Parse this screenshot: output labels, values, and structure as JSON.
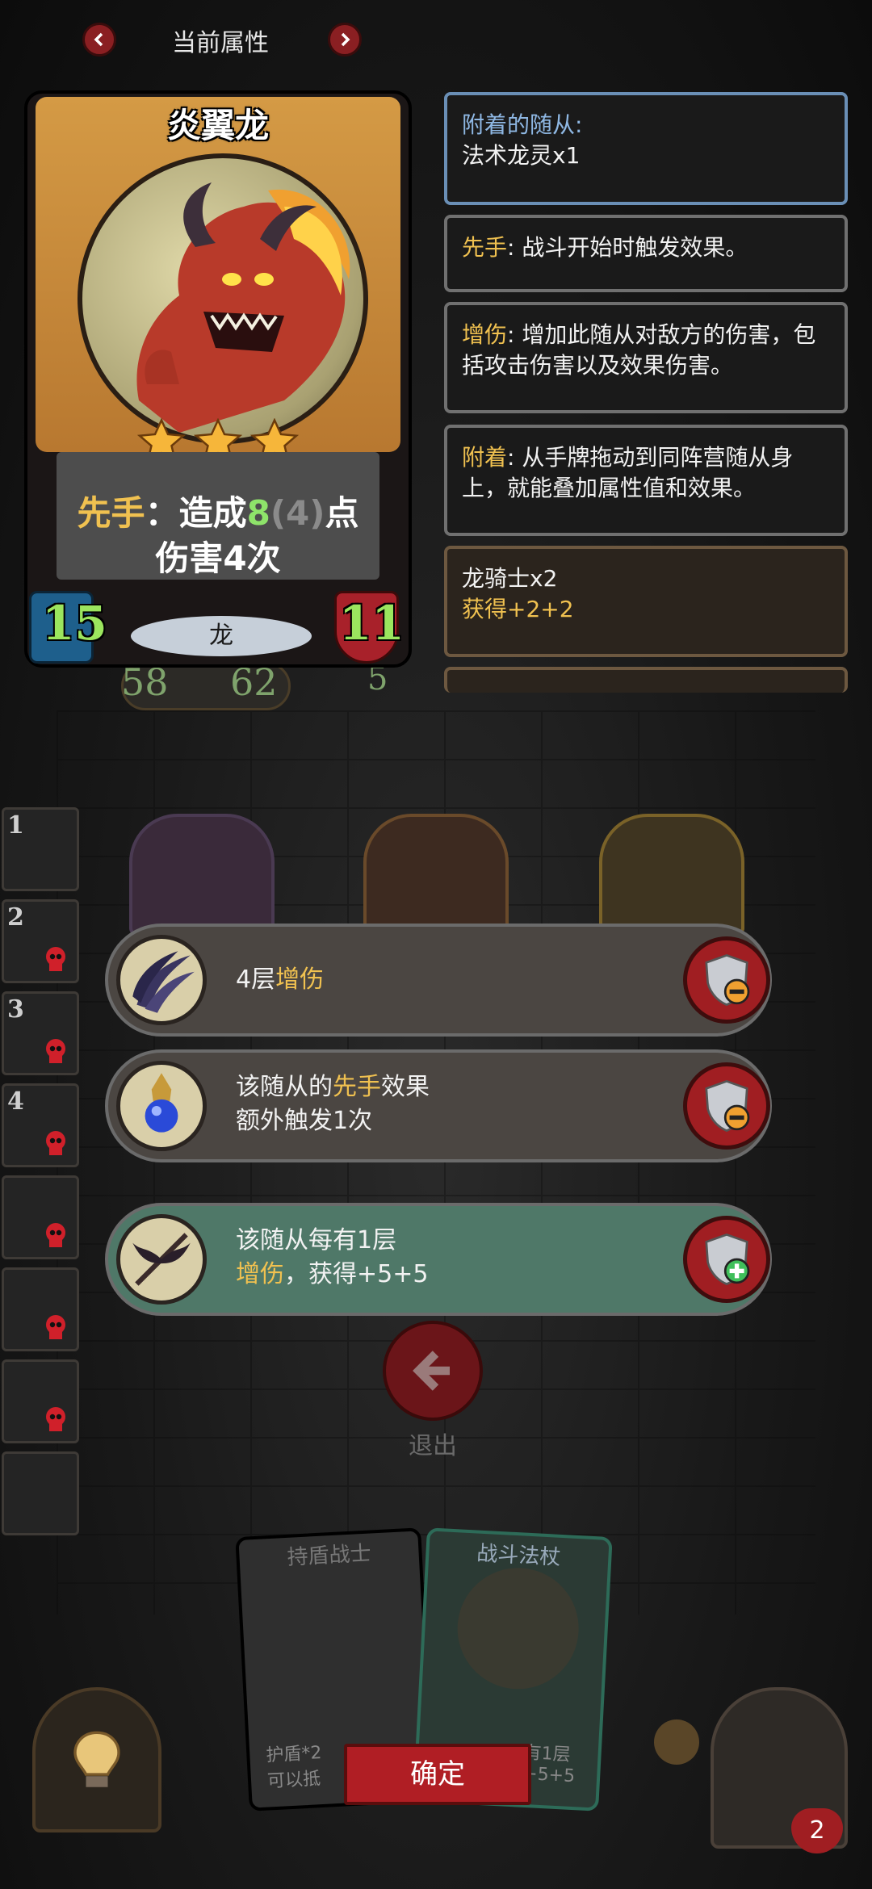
{
  "header": {
    "title": "当前属性"
  },
  "card": {
    "name": "炎翼龙",
    "stars": 3,
    "desc_part1": "先手",
    "desc_part2": "：造成",
    "desc_num": "8",
    "desc_paren": "(4)",
    "desc_part3": "点",
    "desc_line2": "伤害4次",
    "attack": "15",
    "health": "11",
    "tribe": "龙",
    "under_stats": {
      "left": "58",
      "right": "62",
      "mid": "5"
    }
  },
  "panels": {
    "attached_label": "附着的随从:",
    "attached_value": "法术龙灵x1",
    "first_kw": "先手",
    "first_text": ": 战斗开始时触发效果。",
    "boost_kw": "增伤",
    "boost_text": ": 增加此随从对敌方的伤害，包括攻击伤害以及效果伤害。",
    "attach_kw": "附着",
    "attach_text": ": 从手牌拖动到同阵营随从身上，就能叠加属性值和效果。",
    "knight_title": "龙骑士x2",
    "knight_gain_prefix": "获得",
    "knight_gain_value": "+2+2"
  },
  "bars": [
    {
      "num": "4层",
      "kw": "增伤",
      "type": "remove"
    },
    {
      "line1_a": "该随从的",
      "line1_kw": "先手",
      "line1_b": "效果",
      "line2": "额外触发1次",
      "type": "remove"
    },
    {
      "line1": "该随从每有1层",
      "line2_kw": "增伤",
      "line2_b": "，获得+5+5",
      "type": "add"
    }
  ],
  "exit_label": "退出",
  "hand": {
    "card1_name": "持盾战士",
    "card1_text1": "护盾*2",
    "card1_text2": "可以抵",
    "card2_name": "战斗法杖",
    "card2_text1": "有1层",
    "card2_text2": "+5+5"
  },
  "confirm_label": "确定",
  "side_slots": [
    "1",
    "2",
    "3",
    "4",
    "",
    "",
    "",
    ""
  ],
  "bottom_right_badge": "2",
  "colors": {
    "accent_gold": "#f0c150",
    "accent_green": "#8ee36a",
    "button_red": "#a01e22",
    "bar_green": "#4f7868"
  }
}
